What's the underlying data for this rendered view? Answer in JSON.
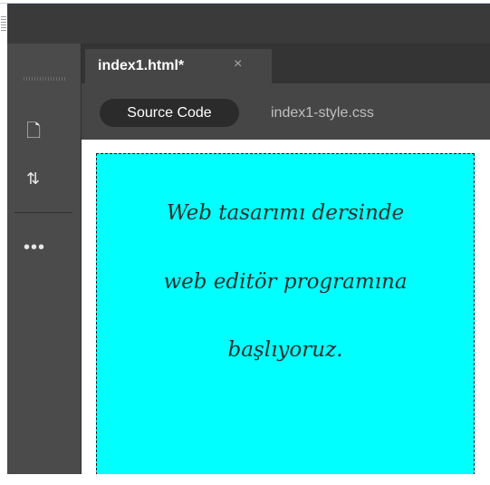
{
  "editor": {
    "tab": {
      "label": "index1.html*",
      "close_icon": "×"
    },
    "related_files": {
      "source_code": "Source Code",
      "css_file": "index1-style.css"
    },
    "toolbar": {
      "file_icon": "🗋",
      "sort_icon": "⇅",
      "more_icon": "•••"
    },
    "canvas": {
      "background_color": "#00ffff",
      "lines": [
        "Web tasarımı dersinde",
        "web editör programına",
        "başlıyoruz."
      ]
    }
  }
}
